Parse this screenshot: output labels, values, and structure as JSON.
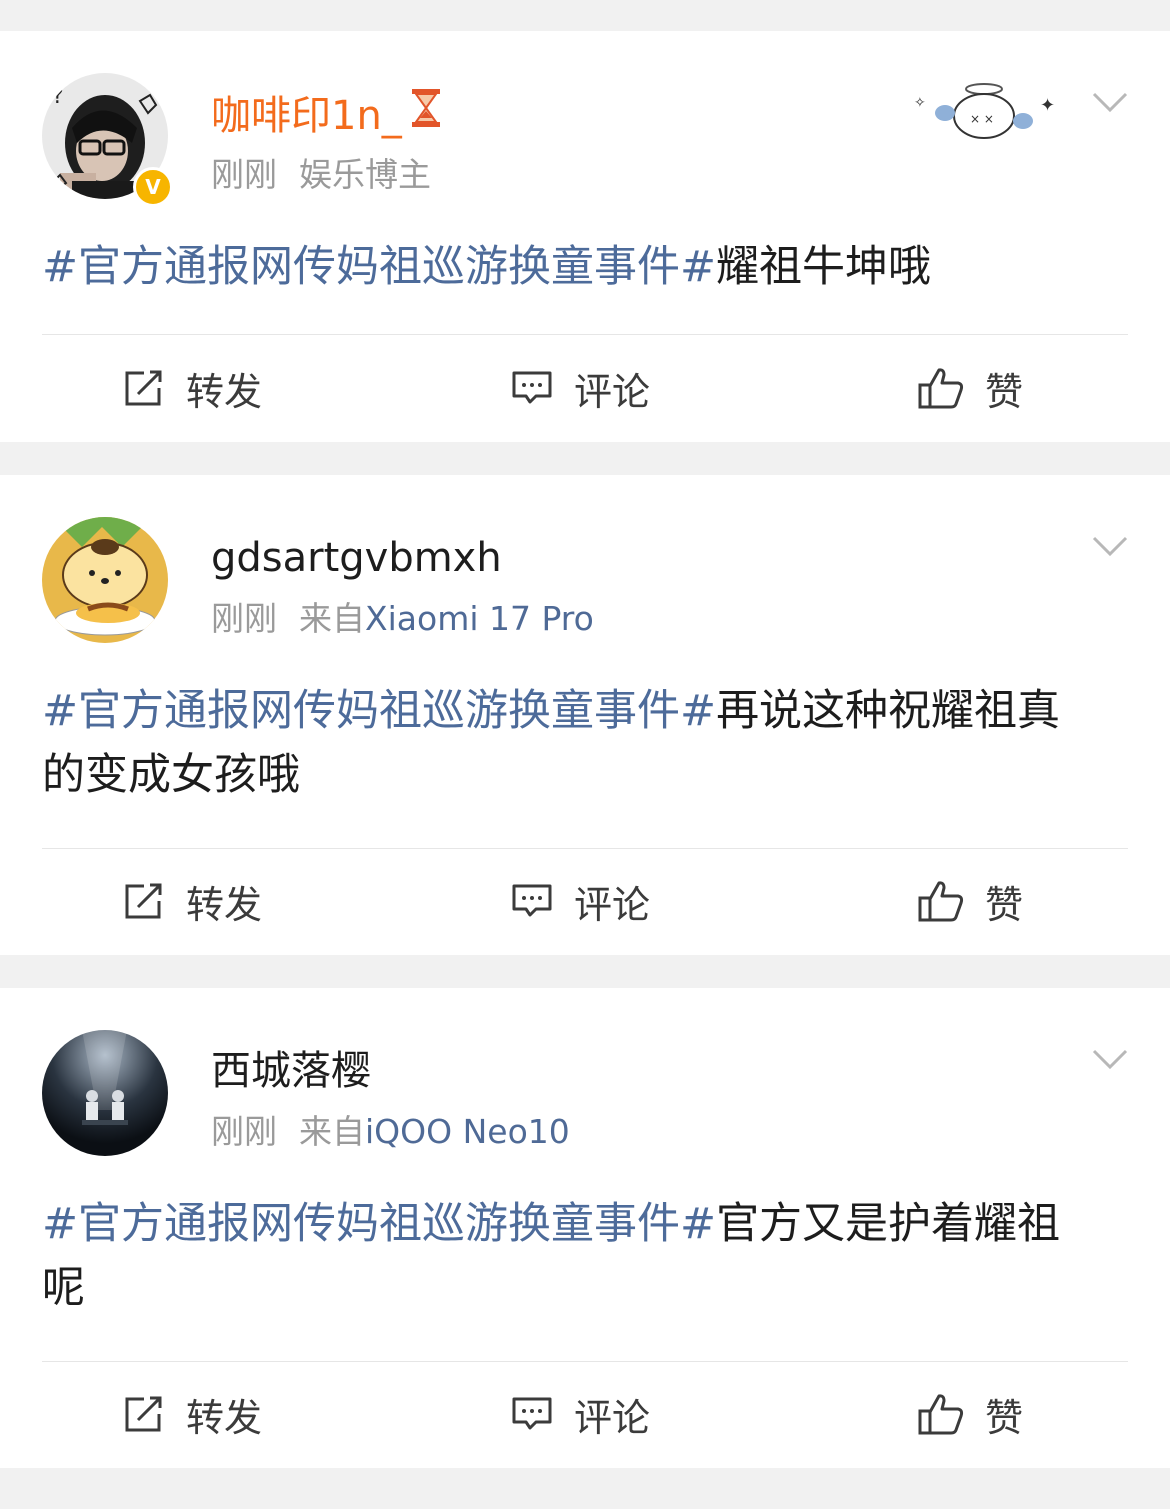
{
  "posts": [
    {
      "username": "咖啡印1n_",
      "username_suffix_icon": "hourglass-icon",
      "verified": true,
      "time": "刚刚",
      "subtitle": "娱乐博主",
      "device": "",
      "topic": "#官方通报网传妈祖巡游换童事件#",
      "text": "耀祖牛坤哦",
      "actions": {
        "repost": "转发",
        "comment": "评论",
        "like": "赞"
      }
    },
    {
      "username": "gdsartgvbmxh",
      "verified": false,
      "time": "刚刚",
      "source_prefix": "来自",
      "device": "Xiaomi 17 Pro",
      "topic": "#官方通报网传妈祖巡游换童事件#",
      "text": "再说这种祝耀祖真的变成女孩哦",
      "actions": {
        "repost": "转发",
        "comment": "评论",
        "like": "赞"
      }
    },
    {
      "username": "西城落樱",
      "verified": false,
      "time": "刚刚",
      "source_prefix": "来自",
      "device": "iQOO Neo10",
      "topic": "#官方通报网传妈祖巡游换童事件#",
      "text": "官方又是护着耀祖呢",
      "actions": {
        "repost": "转发",
        "comment": "评论",
        "like": "赞"
      }
    }
  ],
  "colors": {
    "topic": "#4d6b9a",
    "vip_name": "#f36b1c",
    "meta": "#9a9a9a",
    "verified_badge": "#f7b500",
    "background": "#f1f1f1"
  }
}
